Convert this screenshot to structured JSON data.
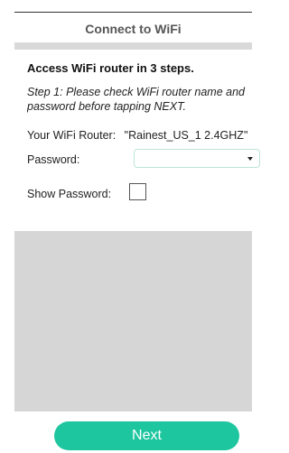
{
  "header": {
    "title": "Connect to WiFi"
  },
  "instructions": {
    "heading": "Access WiFi router in 3 steps.",
    "step_line1": "Step 1: Please check WiFi router name and",
    "step_line2": "password before tapping NEXT."
  },
  "router": {
    "label": "Your WiFi Router:",
    "name": "\"Rainest_US_1 2.4GHZ\""
  },
  "password": {
    "label": "Password:",
    "value": "",
    "placeholder": ""
  },
  "show_password": {
    "label": "Show Password:",
    "checked": false
  },
  "next_button": {
    "label": "Next",
    "color": "#1ec6a0"
  }
}
